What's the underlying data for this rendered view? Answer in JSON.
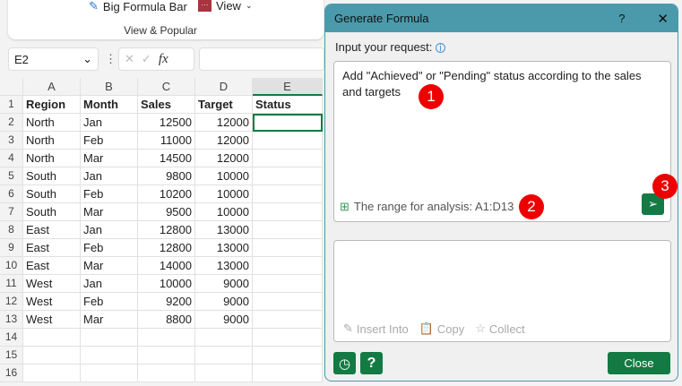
{
  "ribbon": {
    "big_formula_bar": "Big Formula Bar",
    "view": "View",
    "group": "View & Popular"
  },
  "formula_bar": {
    "name_box": "E2",
    "fx": "fx",
    "formula": ""
  },
  "sheet": {
    "columns": [
      "A",
      "B",
      "C",
      "D",
      "E"
    ],
    "rows": [
      [
        "Region",
        "Month",
        "Sales",
        "Target",
        "Status"
      ],
      [
        "North",
        "Jan",
        "12500",
        "12000",
        ""
      ],
      [
        "North",
        "Feb",
        "11000",
        "12000",
        ""
      ],
      [
        "North",
        "Mar",
        "14500",
        "12000",
        ""
      ],
      [
        "South",
        "Jan",
        "9800",
        "10000",
        ""
      ],
      [
        "South",
        "Feb",
        "10200",
        "10000",
        ""
      ],
      [
        "South",
        "Mar",
        "9500",
        "10000",
        ""
      ],
      [
        "East",
        "Jan",
        "12800",
        "13000",
        ""
      ],
      [
        "East",
        "Feb",
        "12800",
        "13000",
        ""
      ],
      [
        "East",
        "Mar",
        "14000",
        "13000",
        ""
      ],
      [
        "West",
        "Jan",
        "10000",
        "9000",
        ""
      ],
      [
        "West",
        "Feb",
        "9200",
        "9000",
        ""
      ],
      [
        "West",
        "Mar",
        "8800",
        "9000",
        ""
      ],
      [
        "",
        "",
        "",
        "",
        ""
      ],
      [
        "",
        "",
        "",
        "",
        ""
      ],
      [
        "",
        "",
        "",
        "",
        ""
      ]
    ],
    "selected_cell": "E2"
  },
  "dialog": {
    "title": "Generate Formula",
    "help": "?",
    "close_x": "✕",
    "input_label": "Input your request:",
    "request": "Add \"Achieved\" or \"Pending\" status according to the sales and targets",
    "range": "The range for analysis: A1:D13",
    "insert": "Insert Into",
    "copy": "Copy",
    "collect": "Collect",
    "close": "Close",
    "help_btn": "?",
    "badges": [
      "1",
      "2",
      "3"
    ],
    "accent": "#137a43",
    "title_color": "#4a9aab"
  }
}
